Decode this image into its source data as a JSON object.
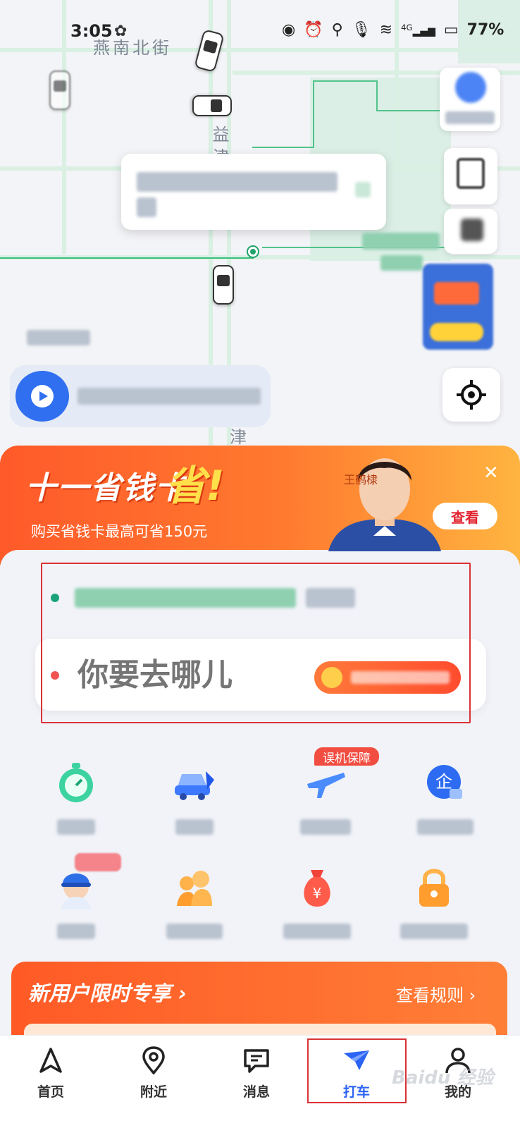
{
  "status_bar": {
    "time": "3:05",
    "battery": "77%",
    "network": "4G"
  },
  "map": {
    "street_top": "燕南北街",
    "street_yi": "益",
    "street_jin_top": "津",
    "street_jin_bottom": "津"
  },
  "promo_banner": {
    "title": "十一省钱卡",
    "title_big": "省!",
    "subtitle": "购买省钱卡最高可省150元",
    "celebrity_name": "王鹤棣",
    "view_button": "查看",
    "close_icon": "close-icon"
  },
  "route": {
    "destination_placeholder": "你要去哪儿"
  },
  "services": {
    "row1": [
      {
        "icon": "stopwatch-icon"
      },
      {
        "icon": "car-icon"
      },
      {
        "icon": "airplane-icon",
        "badge": "误机保障"
      },
      {
        "icon": "enterprise-icon"
      }
    ],
    "row2": [
      {
        "icon": "driver-icon"
      },
      {
        "icon": "family-icon"
      },
      {
        "icon": "money-bag-icon"
      },
      {
        "icon": "lock-icon"
      }
    ]
  },
  "new_user": {
    "title": "新用户限时专享 ›",
    "rules": "查看规则 ›"
  },
  "bottom_nav": [
    {
      "label": "首页",
      "icon": "navigate-arrow-icon"
    },
    {
      "label": "附近",
      "icon": "location-pin-icon"
    },
    {
      "label": "消息",
      "icon": "message-icon"
    },
    {
      "label": "打车",
      "icon": "taxi-icon",
      "active": true
    },
    {
      "label": "我的",
      "icon": "user-icon"
    }
  ],
  "watermark": "Baidu 经验",
  "colors": {
    "accent_blue": "#2b63f4",
    "promo_orange": "#ff5a2a",
    "highlight_red": "#d93236",
    "pickup_green": "#1aa378",
    "dest_red": "#f05252"
  }
}
